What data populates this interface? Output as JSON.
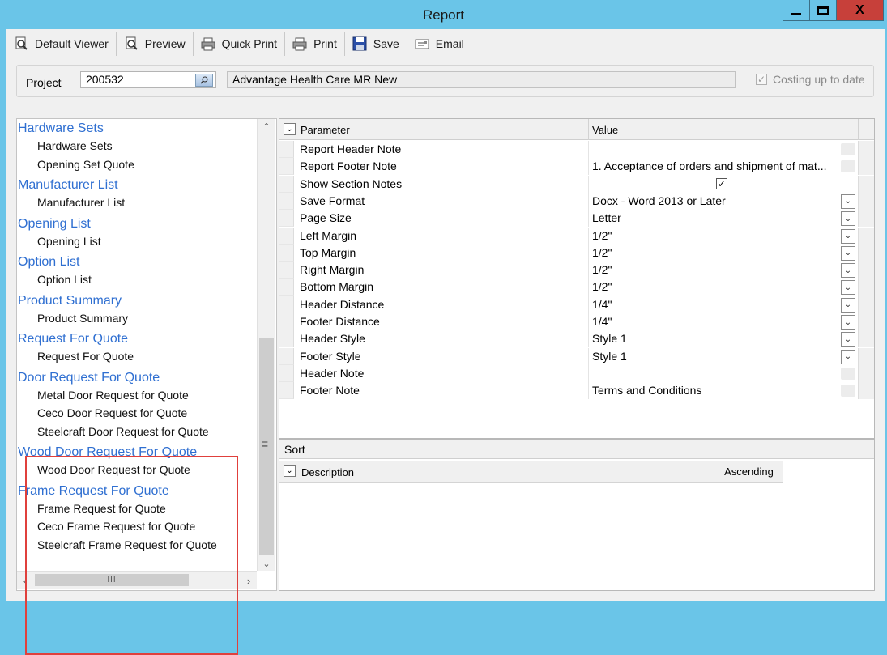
{
  "window": {
    "title": "Report",
    "close_glyph": "X"
  },
  "toolbar": {
    "buttons": [
      {
        "label": "Default Viewer",
        "icon": "default-viewer-icon"
      },
      {
        "label": "Preview",
        "icon": "preview-icon"
      },
      {
        "label": "Quick Print",
        "icon": "quick-print-icon"
      },
      {
        "label": "Print",
        "icon": "print-icon"
      },
      {
        "label": "Save",
        "icon": "save-icon"
      },
      {
        "label": "Email",
        "icon": "email-icon"
      }
    ]
  },
  "project": {
    "label": "Project",
    "number": "200532",
    "name": "Advantage Health Care MR New",
    "costing_label": "Costing up to date",
    "costing_checked": true
  },
  "tree": {
    "items": [
      {
        "type": "group",
        "label": "Hardware Sets"
      },
      {
        "type": "leaf",
        "label": "Hardware Sets"
      },
      {
        "type": "leaf",
        "label": "Opening Set Quote"
      },
      {
        "type": "group",
        "label": "Manufacturer List"
      },
      {
        "type": "leaf",
        "label": "Manufacturer List"
      },
      {
        "type": "group",
        "label": "Opening List"
      },
      {
        "type": "leaf",
        "label": "Opening List"
      },
      {
        "type": "group",
        "label": "Option List"
      },
      {
        "type": "leaf",
        "label": "Option List"
      },
      {
        "type": "group",
        "label": "Product Summary"
      },
      {
        "type": "leaf",
        "label": "Product Summary"
      },
      {
        "type": "group",
        "label": "Request For Quote"
      },
      {
        "type": "leaf",
        "label": "Request For Quote"
      },
      {
        "type": "group",
        "label": "Door Request For Quote"
      },
      {
        "type": "leaf",
        "label": "Metal Door Request for Quote"
      },
      {
        "type": "leaf",
        "label": "Ceco Door Request for Quote"
      },
      {
        "type": "leaf",
        "label": "Steelcraft Door Request for Quote"
      },
      {
        "type": "group",
        "label": "Wood Door Request For Quote"
      },
      {
        "type": "leaf",
        "label": "Wood Door Request for Quote"
      },
      {
        "type": "group",
        "label": "Frame Request For Quote"
      },
      {
        "type": "leaf",
        "label": "Frame Request for Quote"
      },
      {
        "type": "leaf",
        "label": "Ceco Frame Request for Quote"
      },
      {
        "type": "leaf",
        "label": "Steelcraft Frame Request for Quote"
      }
    ],
    "highlight_color": "#e0403c",
    "group_color": "#2f6fd1"
  },
  "parameters": {
    "header_param": "Parameter",
    "header_value": "Value",
    "rows": [
      {
        "name": "Report Header Note",
        "value": "",
        "control": "button"
      },
      {
        "name": "Report Footer Note",
        "value": "1.    Acceptance of orders and shipment of mat...",
        "control": "button"
      },
      {
        "name": "Show Section Notes",
        "value": "",
        "control": "checkbox",
        "checked": true
      },
      {
        "name": "Save Format",
        "value": "Docx - Word 2013 or Later",
        "control": "dropdown"
      },
      {
        "name": "Page Size",
        "value": "Letter",
        "control": "dropdown"
      },
      {
        "name": "Left Margin",
        "value": "1/2\"",
        "control": "dropdown"
      },
      {
        "name": "Top Margin",
        "value": "1/2\"",
        "control": "dropdown"
      },
      {
        "name": "Right Margin",
        "value": "1/2\"",
        "control": "dropdown"
      },
      {
        "name": "Bottom Margin",
        "value": "1/2\"",
        "control": "dropdown"
      },
      {
        "name": "Header Distance",
        "value": "1/4\"",
        "control": "dropdown"
      },
      {
        "name": "Footer Distance",
        "value": "1/4\"",
        "control": "dropdown"
      },
      {
        "name": "Header Style",
        "value": "Style 1",
        "control": "dropdown"
      },
      {
        "name": "Footer Style",
        "value": "Style 1",
        "control": "dropdown"
      },
      {
        "name": "Header Note",
        "value": "",
        "control": "button"
      },
      {
        "name": "Footer Note",
        "value": "Terms and Conditions",
        "control": "button"
      }
    ]
  },
  "sort": {
    "title": "Sort",
    "header_description": "Description",
    "header_order": "Ascending"
  },
  "colors": {
    "titlebar": "#6ac5e8",
    "close_button": "#c7403a",
    "client_bg": "#f0f0f0"
  }
}
